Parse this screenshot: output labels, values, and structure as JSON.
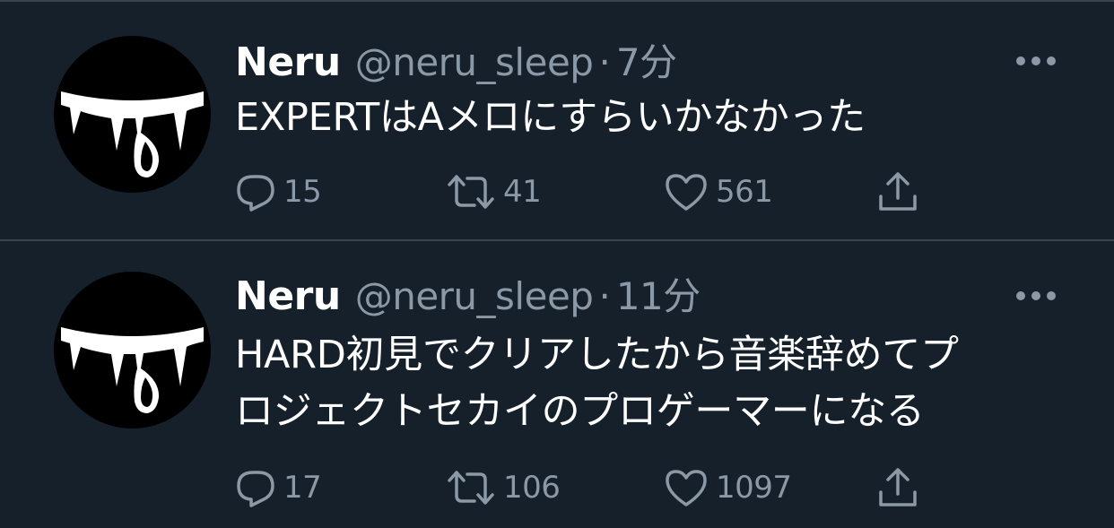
{
  "tweets": [
    {
      "name": "Neru",
      "handle": "@neru_sleep",
      "separator": "·",
      "time": "7分",
      "text": "EXPERTはAメロにすらいかなかった",
      "replies": "15",
      "retweets": "41",
      "likes": "561",
      "avatar_icon": "fanged-mouth-avatar-icon",
      "more_icon": "more-dots-icon"
    },
    {
      "name": "Neru",
      "handle": "@neru_sleep",
      "separator": "·",
      "time": "11分",
      "text": "HARD初見でクリアしたから音楽辞めてプ\nロジェクトセカイのプロゲーマーになる",
      "replies": "17",
      "retweets": "106",
      "likes": "1097",
      "avatar_icon": "fanged-mouth-avatar-icon",
      "more_icon": "more-dots-icon"
    }
  ],
  "colors": {
    "background": "#15202b",
    "divider": "#38444d",
    "secondary_text": "#8b98a5",
    "primary_text": "#ffffff"
  }
}
